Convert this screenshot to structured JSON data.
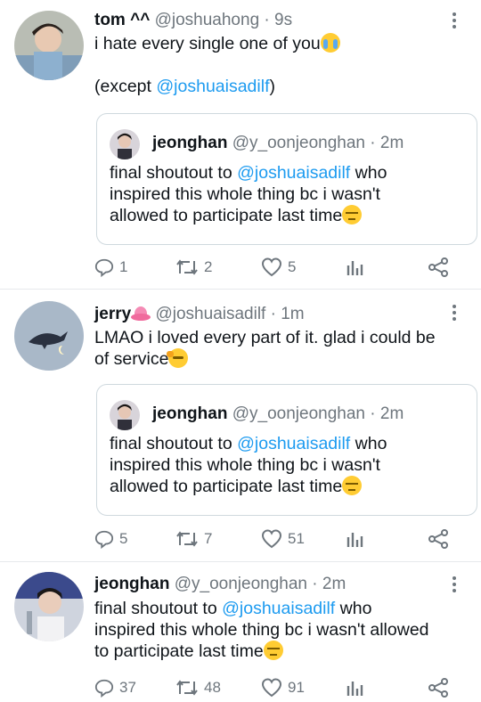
{
  "tweets": [
    {
      "name": "tom ^^",
      "handle": "@joshuahong",
      "time": "· 9s",
      "line1": "i hate every single one of you",
      "line1_emoji": "loudly-crying-face",
      "line2_prefix": "(except ",
      "line2_mention": "@joshuaisadilf",
      "line2_suffix": ")",
      "quote": {
        "name": "jeonghan",
        "handle": "@y_oonjeonghan",
        "time": "· 2m",
        "prefix": "final shoutout to ",
        "mention": "@joshuaisadilf",
        "l1_suffix": " who",
        "l2": "inspired this whole thing bc i wasn't",
        "l3": "allowed to participate last time",
        "emoji": "pensive-face"
      },
      "replies": "1",
      "retweets": "2",
      "likes": "5"
    },
    {
      "name": "jerry",
      "name_emoji": "lotus",
      "handle": "@joshuaisadilf",
      "time": "· 1m",
      "line1": "LMAO i loved every part of it. glad i could be",
      "line2": "of service",
      "line2_emoji": "saluting-face",
      "quote": {
        "name": "jeonghan",
        "handle": "@y_oonjeonghan",
        "time": "· 2m",
        "prefix": "final shoutout to ",
        "mention": "@joshuaisadilf",
        "l1_suffix": " who",
        "l2": "inspired this whole thing bc i wasn't",
        "l3": "allowed to participate last time",
        "emoji": "pensive-face"
      },
      "replies": "5",
      "retweets": "7",
      "likes": "51"
    },
    {
      "name": "jeonghan",
      "handle": "@y_oonjeonghan",
      "time": "· 2m",
      "prefix": "final shoutout to ",
      "mention": "@joshuaisadilf",
      "l1_suffix": " who",
      "l2": "inspired this whole thing bc i wasn't allowed",
      "l3": "to participate last time",
      "emoji": "pensive-face",
      "replies": "37",
      "retweets": "48",
      "likes": "91"
    }
  ],
  "colors": {
    "accent": "#1d9bf0",
    "muted": "#6e767d",
    "text": "#0f1419",
    "border": "#cfd9de"
  }
}
